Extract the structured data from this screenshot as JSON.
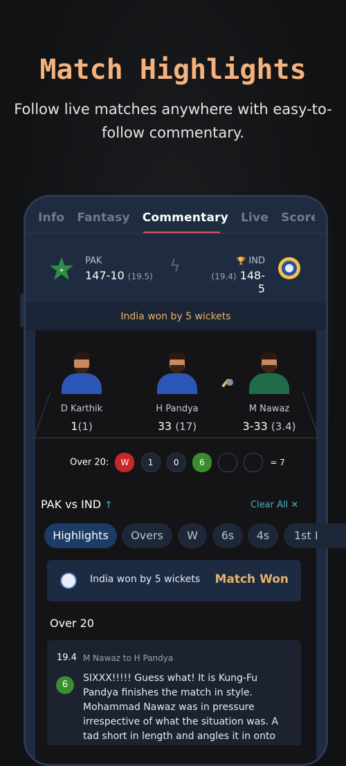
{
  "promo": {
    "title": "Match Highlights",
    "subtitle": "Follow live matches anywhere with easy-to-follow commentary."
  },
  "tabs": [
    {
      "label": "Info",
      "active": false
    },
    {
      "label": "Fantasy",
      "active": false
    },
    {
      "label": "Commentary",
      "active": true
    },
    {
      "label": "Live",
      "active": false
    },
    {
      "label": "Score",
      "active": false
    }
  ],
  "scoreboard": {
    "team1": {
      "code": "PAK",
      "score": "147-10",
      "overs": "(19.5)",
      "icon": "pakistan-star-icon"
    },
    "team2": {
      "code": "IND",
      "score": "148-5",
      "overs": "(19.4)",
      "icon": "india-crest-icon",
      "winner_icon": "trophy-icon"
    },
    "versus_icon": "lightning-bolt-icon",
    "result": "India won by 5 wickets"
  },
  "players": [
    {
      "name": "D Karthik",
      "runs": "1",
      "balls": "(1)",
      "jersey_color": "#2d56b8"
    },
    {
      "name": "H Pandya",
      "runs": "33",
      "balls": "(17)",
      "jersey_color": "#2d56b8",
      "icon": "bat-icon"
    },
    {
      "name": "M Nawaz",
      "runs": "3-33",
      "balls": "(3.4)",
      "jersey_color": "#1f6b4a",
      "icon": "ball-icon"
    }
  ],
  "current_over": {
    "label": "Over 20:",
    "balls": [
      "W",
      "1",
      "0",
      "6",
      "",
      ""
    ],
    "total": "= 7"
  },
  "match": {
    "title": "PAK vs IND",
    "arrow_icon": "arrow-up-icon",
    "clear_all": "Clear All ✕"
  },
  "filters": [
    {
      "label": "Highlights",
      "active": true
    },
    {
      "label": "Overs",
      "active": false
    },
    {
      "label": "W",
      "active": false
    },
    {
      "label": "6s",
      "active": false
    },
    {
      "label": "4s",
      "active": false
    },
    {
      "label": "1st I",
      "active": false
    }
  ],
  "result_card": {
    "text": "India won by 5 wickets",
    "status": "Match Won"
  },
  "commentary": {
    "over_heading": "Over 20",
    "ball": "19.4",
    "bowler_batter": "M Nawaz to H Pandya",
    "runs": "6",
    "text": "SIXXX!!!!! Guess what! It is Kung-Fu Pandya finishes the match in style. Mohammad Nawaz was in pressure irrespective of what the situation was. A tad short in length and angles it in onto the middle stump line. Hardik the"
  },
  "colors": {
    "accent_title": "#f4b27e",
    "result_text": "#e8b36a",
    "wicket": "#c62828",
    "six": "#3c8c2e",
    "active_pill": "#1b3c66"
  }
}
